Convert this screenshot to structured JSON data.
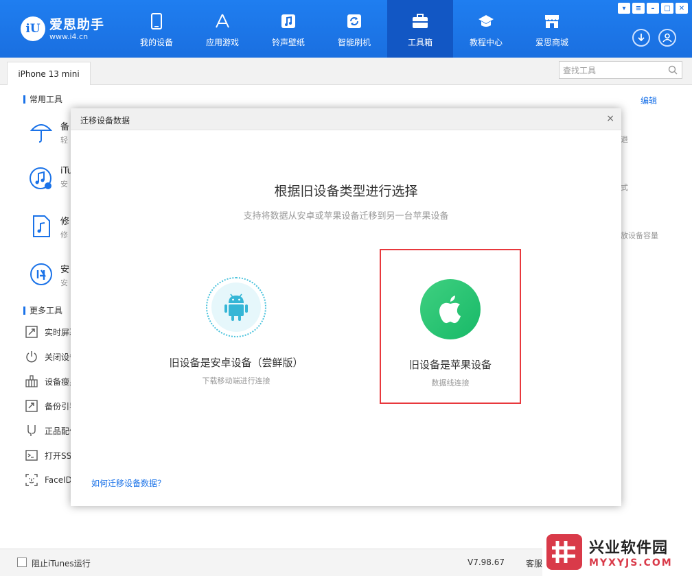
{
  "app": {
    "logo_badge": "iU",
    "logo_name": "爱思助手",
    "logo_url": "www.i4.cn"
  },
  "nav": [
    {
      "label": "我的设备",
      "icon": "phone-icon"
    },
    {
      "label": "应用游戏",
      "icon": "appstore-icon"
    },
    {
      "label": "铃声壁纸",
      "icon": "music-icon"
    },
    {
      "label": "智能刷机",
      "icon": "refresh-icon"
    },
    {
      "label": "工具箱",
      "icon": "toolbox-icon",
      "active": true
    },
    {
      "label": "教程中心",
      "icon": "graduation-cap-icon"
    },
    {
      "label": "爱思商城",
      "icon": "store-icon"
    }
  ],
  "device_tab": "iPhone 13 mini",
  "search": {
    "placeholder": "查找工具"
  },
  "common_tools": {
    "title": "常用工具",
    "edit": "编辑",
    "items": [
      {
        "name": "备",
        "desc": "轻",
        "icon": "umbrella-icon"
      },
      {
        "name": "iTu",
        "desc": "安",
        "icon": "itunes-icon"
      },
      {
        "name": "修",
        "desc": "修",
        "icon": "music-file-icon"
      },
      {
        "name": "安",
        "desc": "安",
        "icon": "i4-icon"
      }
    ],
    "right_fragments": [
      "退",
      "式",
      "放设备容量"
    ]
  },
  "more_tools": {
    "title": "更多工具",
    "items": [
      {
        "label": "实时屏幕",
        "icon": "screen-icon"
      },
      {
        "label": "关闭设备",
        "icon": "power-icon"
      },
      {
        "label": "设备瘦身",
        "icon": "broom-icon"
      },
      {
        "label": "备份引导",
        "icon": "backup-icon"
      },
      {
        "label": "正品配件",
        "icon": "accessory-icon"
      },
      {
        "label": "打开SSH",
        "icon": "terminal-icon"
      },
      {
        "label": "FaceID",
        "icon": "faceid-icon"
      }
    ]
  },
  "dialog": {
    "title": "迁移设备数据",
    "close": "×",
    "heading": "根据旧设备类型进行选择",
    "subheading": "支持将数据从安卓或苹果设备迁移到另一台苹果设备",
    "options": [
      {
        "label": "旧设备是安卓设备（尝鲜版）",
        "desc": "下载移动端进行连接",
        "icon": "android-icon"
      },
      {
        "label": "旧设备是苹果设备",
        "desc": "数据线连接",
        "icon": "apple-icon",
        "highlighted": true
      }
    ],
    "help_link": "如何迁移设备数据？"
  },
  "bottom": {
    "block_itunes": "阻止iTunes运行",
    "version": "V7.98.67",
    "service": "客服"
  },
  "watermark": {
    "cn": "兴业软件园",
    "en": "MYXYJS.COM"
  },
  "colors": {
    "brand_blue": "#1a72e8",
    "nav_active": "#1257c4",
    "highlight_red": "#e8383d",
    "apple_green": "#2cc574"
  }
}
